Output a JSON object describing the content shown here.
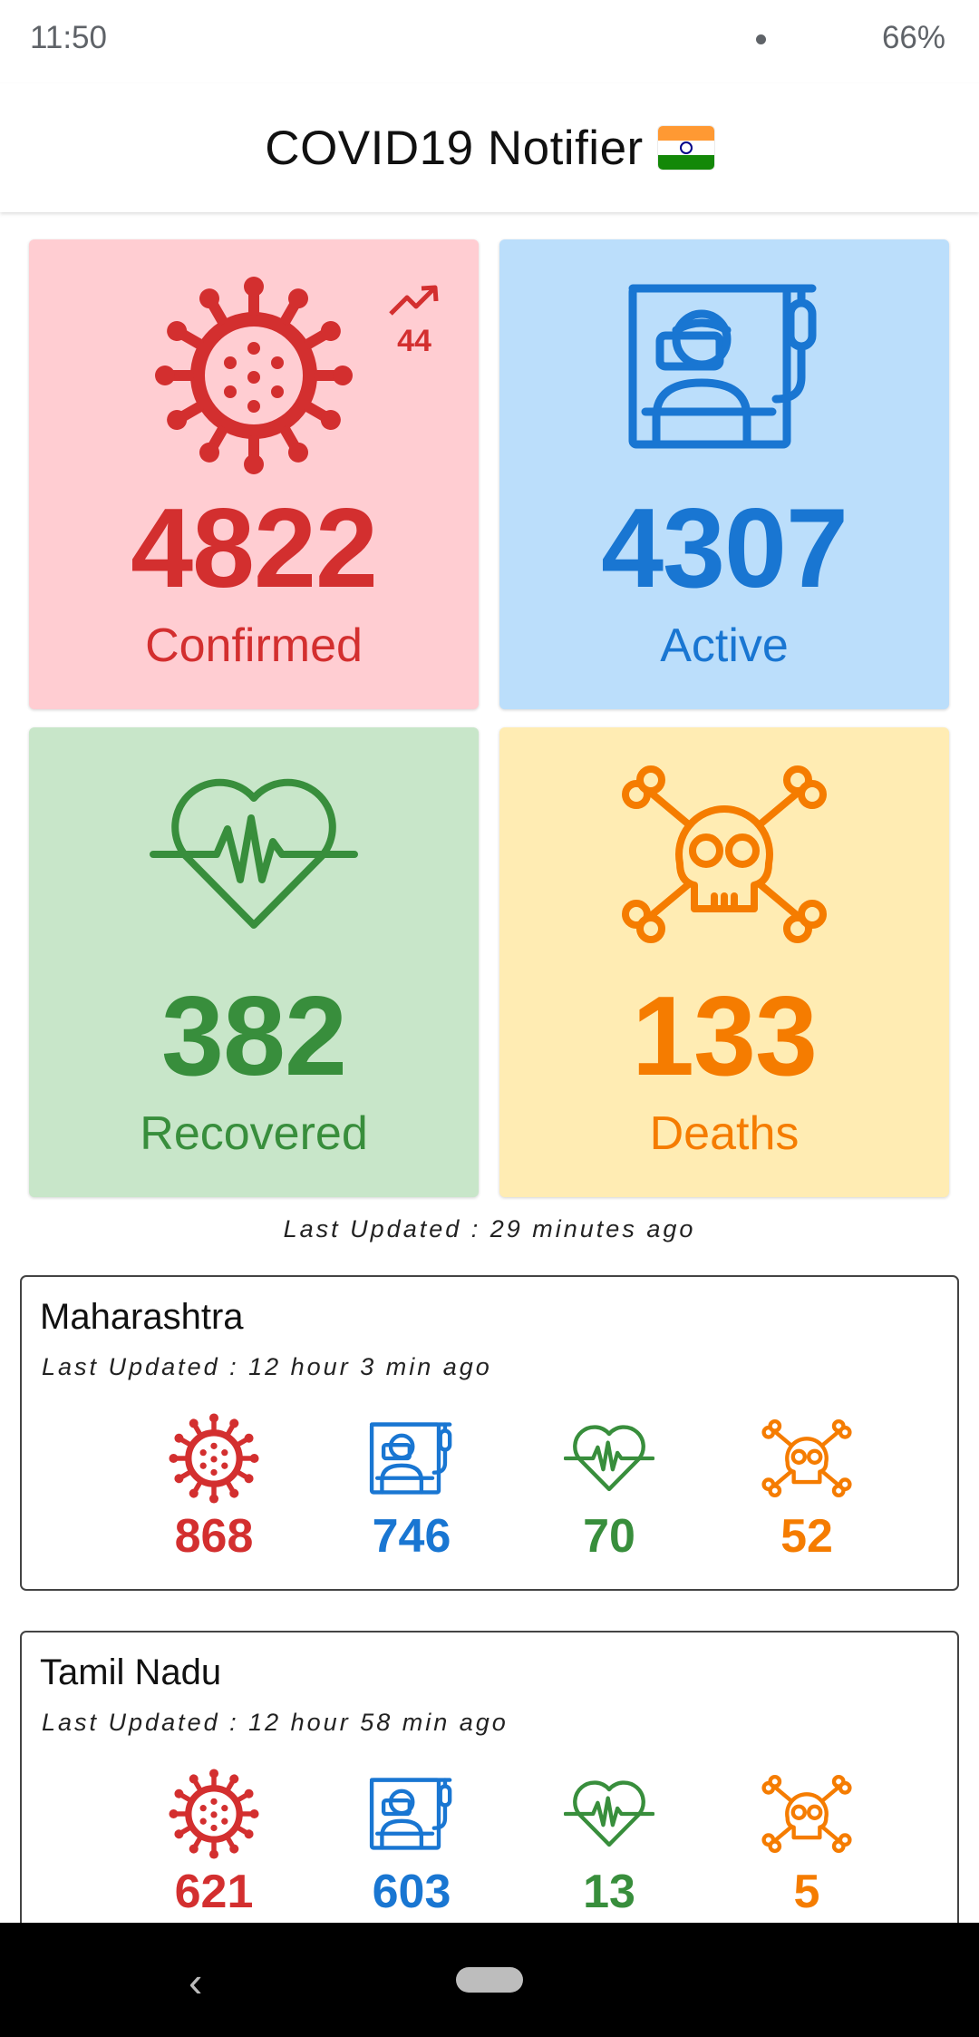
{
  "status_bar": {
    "time": "11:50",
    "battery": "66%"
  },
  "app_bar": {
    "title": "COVID19 Notifier"
  },
  "totals": {
    "confirmed": {
      "value": "4822",
      "label": "Confirmed",
      "delta": "44",
      "color": "#d32f2f",
      "bg": "#ffcdd2",
      "icon": "virus-icon"
    },
    "active": {
      "value": "4307",
      "label": "Active",
      "color": "#1976d2",
      "bg": "#bbdefb",
      "icon": "hospital-bed-icon"
    },
    "recovered": {
      "value": "382",
      "label": "Recovered",
      "color": "#388e3c",
      "bg": "#c8e6c9",
      "icon": "heartbeat-icon"
    },
    "deaths": {
      "value": "133",
      "label": "Deaths",
      "color": "#f57c00",
      "bg": "#ffecb3",
      "icon": "skull-crossbones-icon"
    }
  },
  "last_updated": "Last Updated : 29 minutes ago",
  "states": [
    {
      "name": "Maharashtra",
      "updated": "Last Updated : 12 hour 3 min ago",
      "confirmed": "868",
      "active": "746",
      "recovered": "70",
      "deaths": "52"
    },
    {
      "name": "Tamil Nadu",
      "updated": "Last Updated : 12 hour 58 min ago",
      "confirmed": "621",
      "active": "603",
      "recovered": "13",
      "deaths": "5"
    }
  ]
}
